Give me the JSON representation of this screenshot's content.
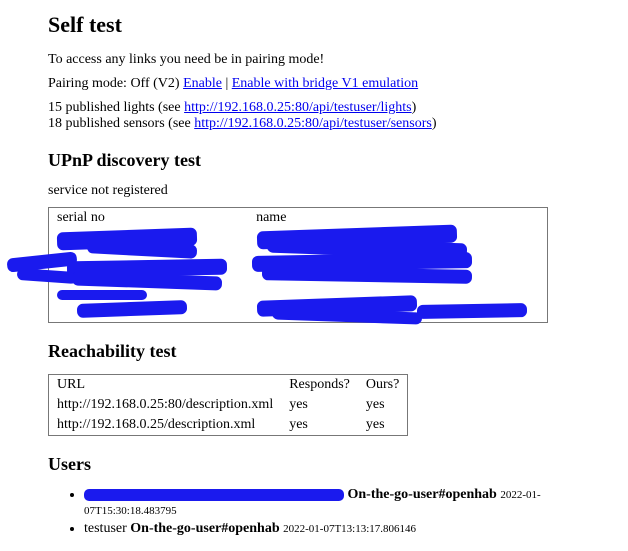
{
  "title": "Self test",
  "access_note": "To access any links you need be in pairing mode!",
  "pairing": {
    "label": "Pairing mode:",
    "status": "Off (V2)",
    "enable_label": "Enable",
    "enable_v1_label": "Enable with bridge V1 emulation"
  },
  "published": {
    "lights_prefix": "15 published lights (see ",
    "lights_url": "http://192.168.0.25:80/api/testuser/lights",
    "lights_suffix": ")",
    "sensors_prefix": "18 published sensors (see ",
    "sensors_url": "http://192.168.0.25:80/api/testuser/sensors",
    "sensors_suffix": ")"
  },
  "upnp": {
    "heading": "UPnP discovery test",
    "status": "service not registered",
    "headers": {
      "serial": "serial no",
      "name": "name"
    }
  },
  "reachability": {
    "heading": "Reachability test",
    "headers": {
      "url": "URL",
      "responds": "Responds?",
      "ours": "Ours?"
    },
    "rows": [
      {
        "url": "http://192.168.0.25:80/description.xml",
        "responds": "yes",
        "ours": "yes"
      },
      {
        "url": "http://192.168.0.25/description.xml",
        "responds": "yes",
        "ours": "yes"
      }
    ]
  },
  "users": {
    "heading": "Users",
    "items": [
      {
        "name": "",
        "redacted": true,
        "label": "On-the-go-user#openhab",
        "ts": "2022-01-07T15:30:18.483795"
      },
      {
        "name": "testuser",
        "redacted": false,
        "label": "On-the-go-user#openhab",
        "ts": "2022-01-07T13:13:17.806146"
      }
    ]
  }
}
